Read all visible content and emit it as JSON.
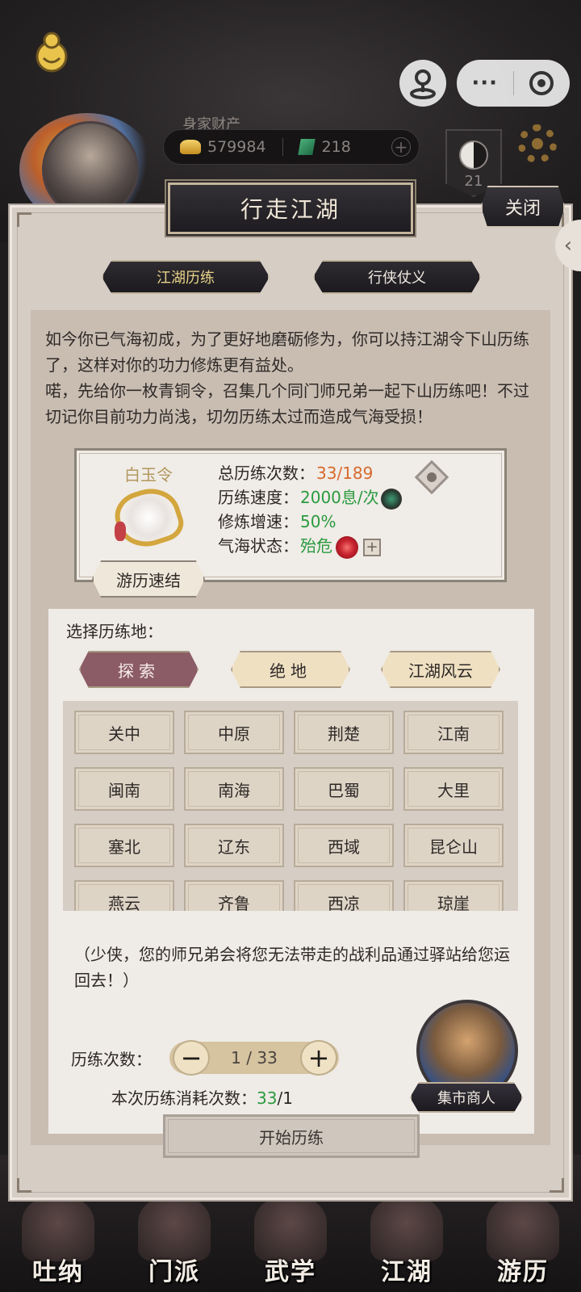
{
  "hud": {
    "wealth_title": "身家财产",
    "silver": "579984",
    "jade": "218",
    "plus": "+",
    "level": "21"
  },
  "miniprogram": {
    "more": "···"
  },
  "panel": {
    "title": "行走江湖",
    "close_label": "关闭",
    "side_tab": "‹",
    "tabs": [
      {
        "label": "江湖历练",
        "active": true
      },
      {
        "label": "行侠仗义",
        "active": false
      }
    ],
    "story": [
      "如今你已气海初成，为了更好地磨砺修为，你可以持江湖令下山历练了，这样对你的功力修炼更有益处。",
      "喏，先给你一枚青铜令，召集几个同门师兄弟一起下山历练吧！不过切记你目前功力尚浅，切勿历练太过而造成气海受损！"
    ]
  },
  "token": {
    "name": "白玉令",
    "quick_finish": "游历速结",
    "stats": [
      {
        "label": "总历练次数：",
        "value": "33/189",
        "color": "#d66a2d"
      },
      {
        "label": "历练速度：",
        "value": "2000息/次",
        "color": "#2a9a3f"
      },
      {
        "label": "修炼增速：",
        "value": "50%",
        "color": "#2a9a3f"
      },
      {
        "label": "气海状态：",
        "value": "殆危",
        "color": "#2a9a3f"
      }
    ],
    "plus_box": "+"
  },
  "select": {
    "label": "选择历练地：",
    "categories": [
      "探索",
      "绝地",
      "江湖风云"
    ],
    "locations": [
      "关中",
      "中原",
      "荆楚",
      "江南",
      "闽南",
      "南海",
      "巴蜀",
      "大里",
      "塞北",
      "辽东",
      "西域",
      "昆仑山",
      "燕云",
      "齐鲁",
      "西凉",
      "琼崖"
    ]
  },
  "notice": "（少侠，您的师兄弟会将您无法带走的战利品通过驿站给您运回去！）",
  "counter": {
    "label": "历练次数：",
    "minus": "−",
    "plus": "+",
    "value": "1 / 33",
    "consume_label": "本次历练消耗次数：",
    "consume_value": "33",
    "consume_suffix": "/1"
  },
  "merchant": {
    "label": "集市商人"
  },
  "start_label": "开始历练",
  "bottom_nav": [
    "吐纳",
    "门派",
    "武学",
    "江湖",
    "游历"
  ],
  "colors": {
    "accent_gold": "#e9d38a",
    "selected_category": "#8c5c66",
    "panel_bg": "#d6cdc5"
  }
}
